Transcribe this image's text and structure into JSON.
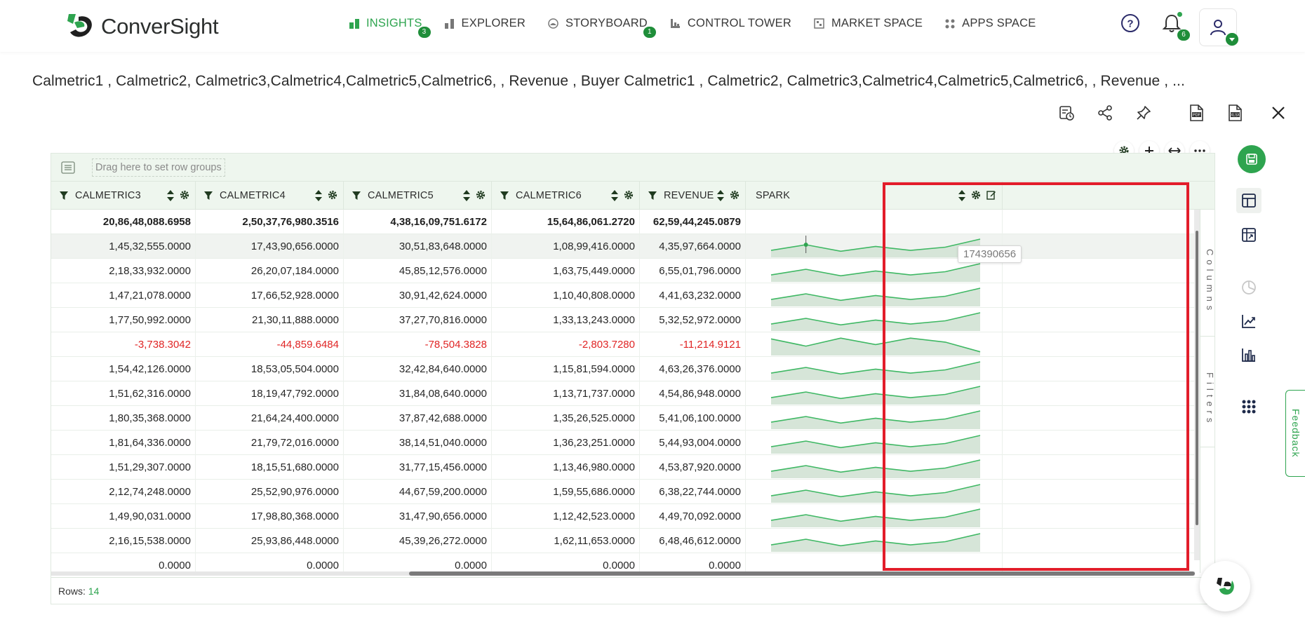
{
  "brand": {
    "name": "ConverSight",
    "accent": "#2ea44f",
    "dark_green": "#1f8e3a",
    "highlight": "#e21d2a",
    "negative": "#e02525"
  },
  "nav": [
    {
      "label": "INSIGHTS",
      "icon": "bar-chart-icon",
      "badge": "3",
      "active": true
    },
    {
      "label": "EXPLORER",
      "icon": "explorer-icon",
      "badge": "",
      "active": false
    },
    {
      "label": "STORYBOARD",
      "icon": "storyboard-icon",
      "badge": "1",
      "active": false
    },
    {
      "label": "CONTROL TOWER",
      "icon": "control-tower-icon",
      "badge": "",
      "active": false
    },
    {
      "label": "MARKET SPACE",
      "icon": "market-space-icon",
      "badge": "",
      "active": false
    },
    {
      "label": "APPS SPACE",
      "icon": "apps-space-icon",
      "badge": "",
      "active": false
    }
  ],
  "notifications": {
    "count": "6"
  },
  "title": "Calmetric1 , Calmetric2, Calmetric3,Calmetric4,Calmetric5,Calmetric6, , Revenue , Buyer Calmetric1 , Calmetric2, Calmetric3,Calmetric4,Calmetric5,Calmetric6, , Revenue , ...",
  "grid": {
    "group_placeholder": "Drag here to set row groups",
    "columns": [
      "CALMETRIC3",
      "CALMETRIC4",
      "CALMETRIC5",
      "CALMETRIC6",
      "REVENUE",
      "SPARK"
    ],
    "side_tabs": [
      "Columns",
      "Filters"
    ],
    "tooltip": "174390656",
    "total_row": [
      "20,86,48,088.6958",
      "2,50,37,76,980.3516",
      "4,38,16,09,751.6172",
      "15,64,86,061.2720",
      "62,59,44,245.0879"
    ],
    "rows": [
      [
        "1,45,32,555.0000",
        "17,43,90,656.0000",
        "30,51,83,648.0000",
        "1,08,99,416.0000",
        "4,35,97,664.0000"
      ],
      [
        "2,18,33,932.0000",
        "26,20,07,184.0000",
        "45,85,12,576.0000",
        "1,63,75,449.0000",
        "6,55,01,796.0000"
      ],
      [
        "1,47,21,078.0000",
        "17,66,52,928.0000",
        "30,91,42,624.0000",
        "1,10,40,808.0000",
        "4,41,63,232.0000"
      ],
      [
        "1,77,50,992.0000",
        "21,30,11,888.0000",
        "37,27,70,816.0000",
        "1,33,13,243.0000",
        "5,32,52,972.0000"
      ],
      [
        "-3,738.3042",
        "-44,859.6484",
        "-78,504.3828",
        "-2,803.7280",
        "-11,214.9121"
      ],
      [
        "1,54,42,126.0000",
        "18,53,05,504.0000",
        "32,42,84,640.0000",
        "1,15,81,594.0000",
        "4,63,26,376.0000"
      ],
      [
        "1,51,62,316.0000",
        "18,19,47,792.0000",
        "31,84,08,640.0000",
        "1,13,71,737.0000",
        "4,54,86,948.0000"
      ],
      [
        "1,80,35,368.0000",
        "21,64,24,400.0000",
        "37,87,42,688.0000",
        "1,35,26,525.0000",
        "5,41,06,100.0000"
      ],
      [
        "1,81,64,336.0000",
        "21,79,72,016.0000",
        "38,14,51,040.0000",
        "1,36,23,251.0000",
        "5,44,93,004.0000"
      ],
      [
        "1,51,29,307.0000",
        "18,15,51,680.0000",
        "31,77,15,456.0000",
        "1,13,46,980.0000",
        "4,53,87,920.0000"
      ],
      [
        "2,12,74,248.0000",
        "25,52,90,976.0000",
        "44,67,59,200.0000",
        "1,59,55,686.0000",
        "6,38,22,744.0000"
      ],
      [
        "1,49,90,031.0000",
        "17,98,80,368.0000",
        "31,47,90,656.0000",
        "1,12,42,523.0000",
        "4,49,70,092.0000"
      ],
      [
        "2,16,15,538.0000",
        "25,93,86,448.0000",
        "45,39,26,272.0000",
        "1,62,11,653.0000",
        "6,48,46,612.0000"
      ],
      [
        "0.0000",
        "0.0000",
        "0.0000",
        "0.0000",
        "0.0000"
      ]
    ],
    "negative_row_index": 4,
    "footer_label": "Rows:",
    "footer_count": "14"
  },
  "feedback": "Feedback"
}
